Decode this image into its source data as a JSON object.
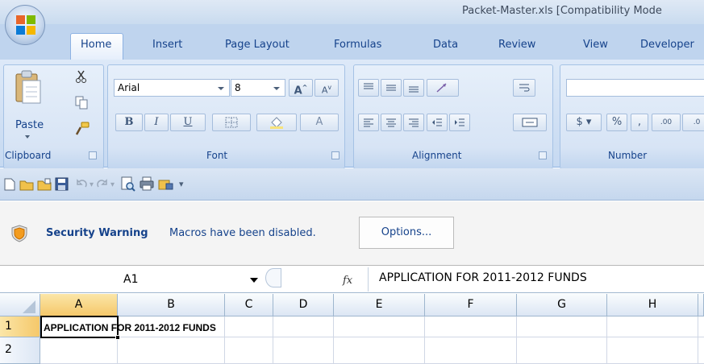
{
  "window": {
    "title": "Packet-Master.xls  [Compatibility Mode"
  },
  "tabs": [
    "Home",
    "Insert",
    "Page Layout",
    "Formulas",
    "Data",
    "Review",
    "View",
    "Developer"
  ],
  "active_tab": "Home",
  "clipboard": {
    "paste_label": "Paste",
    "group_label": "Clipboard"
  },
  "font": {
    "name": "Arial",
    "size": "8",
    "group_label": "Font",
    "bold": "B",
    "italic": "I",
    "underline": "U",
    "grow": "A",
    "shrink": "A",
    "font_color": "A"
  },
  "alignment": {
    "group_label": "Alignment"
  },
  "number": {
    "group_label": "Number",
    "currency": "$",
    "percent": "%",
    "comma": ",",
    "increase_decimal": ".00",
    "decrease_decimal": ".0"
  },
  "security": {
    "title": "Security Warning",
    "message": "Macros have been disabled.",
    "options_label": "Options..."
  },
  "formula_bar": {
    "name_box": "A1",
    "fx": "fx",
    "content": "APPLICATION FOR 2011-2012 FUNDS"
  },
  "columns": [
    "A",
    "B",
    "C",
    "D",
    "E",
    "F",
    "G",
    "H"
  ],
  "rows": [
    "1",
    "2"
  ],
  "cells": {
    "A1": "APPLICATION FOR 2011-2012 FUNDS"
  },
  "colors": {
    "accent": "#15428b",
    "ribbon": "#c6d9f1",
    "selected_header": "#f5c86a"
  }
}
